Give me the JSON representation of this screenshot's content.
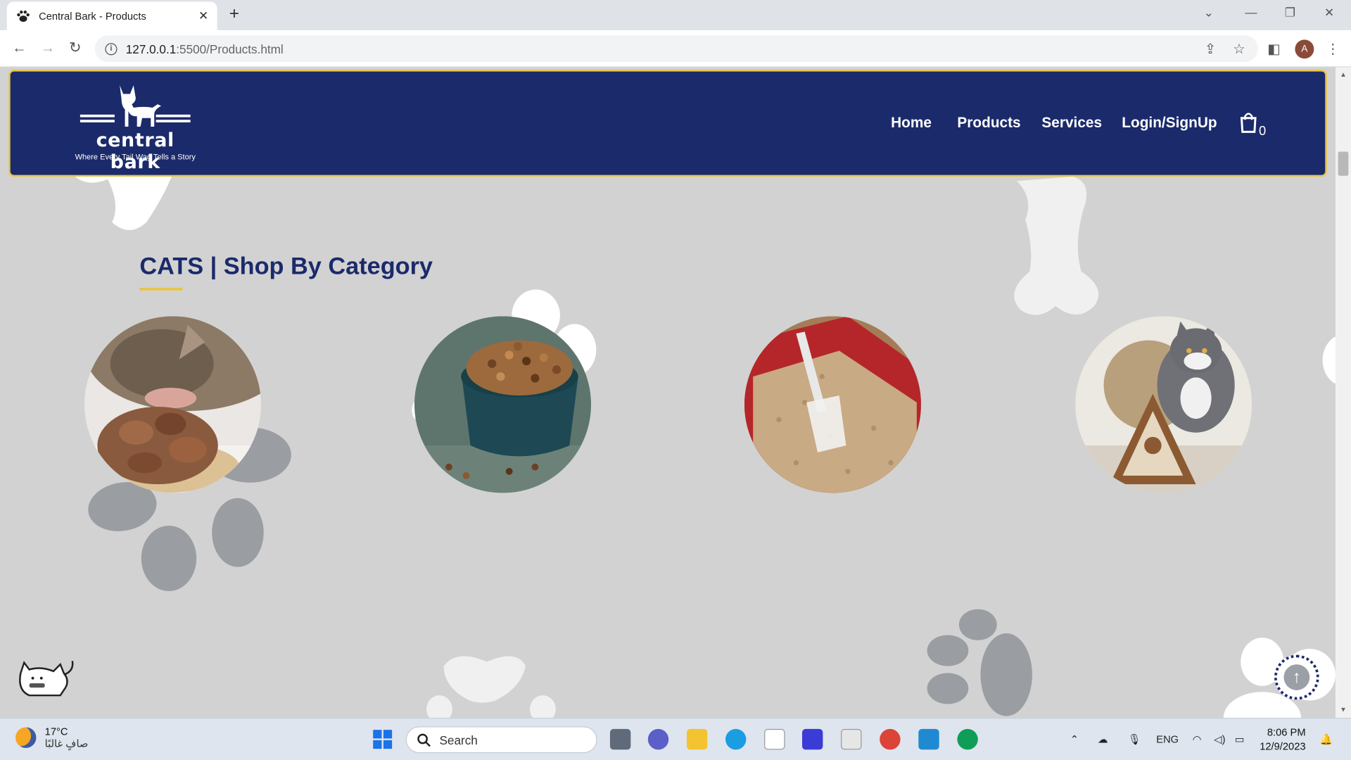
{
  "browser": {
    "tab_title": "Central Bark - Products",
    "new_tab_icon": "plus-icon",
    "url_host": "127.0.0.1",
    "url_path": ":5500/Products.html",
    "profile_initial": "A"
  },
  "site": {
    "brand": "central bark",
    "tagline": "Where Every Tail Wag Tells a Story",
    "nav": [
      "Home",
      "Products",
      "Services",
      "Login/SignUp"
    ],
    "cart_count": "0"
  },
  "main": {
    "heading": "CATS | Shop By Category",
    "categories": [
      "cat-wet-food",
      "cat-dry-food",
      "cat-litter",
      "cat-toys"
    ]
  },
  "taskbar": {
    "temperature": "17°C",
    "weather_desc": "صافٍ غالبًا",
    "search_label": "Search",
    "language": "ENG",
    "time": "8:06 PM",
    "date": "12/9/2023"
  },
  "colors": {
    "header_bg": "#1b2a6b",
    "accent": "#e8c547",
    "page_bg": "#d2d2d2"
  }
}
